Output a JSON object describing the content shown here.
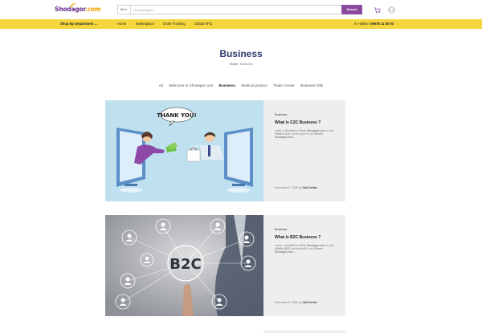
{
  "header": {
    "logo_text": "Shodagor",
    "logo_suffix": ".com",
    "search": {
      "category": "All",
      "placeholder": "I'm looking for...",
      "button_label": "Search"
    },
    "colors": {
      "brand": "#6b2d8f",
      "accent": "#f5d63d",
      "search_button": "#8b4aa0"
    },
    "icons": [
      "cart-icon",
      "user-avatar-icon"
    ]
  },
  "navbar": {
    "department_label": "Shop By Department",
    "links": [
      "Home",
      "Marketplace",
      "Order Tracking",
      "Global RFQ"
    ],
    "hotline_label": "Hotline:",
    "hotline_number": "09678 11 00 00"
  },
  "page": {
    "title": "Business",
    "breadcrumb_home": "Home",
    "breadcrumb_sep": "/",
    "breadcrumb_current": "Business"
  },
  "filters": {
    "items": [
      "All",
      "Welcome to Shodagor.com",
      "Business",
      "Medical product",
      "Trade Center",
      "Business Talk"
    ],
    "active": "Business"
  },
  "posts": [
    {
      "category": "Business",
      "title": "What is C2C Business ?",
      "excerpt": "ব্যবসা ও অনলাইনের মাধ্যমে Shodagor.com এর মত প্রতিষ্ঠান C2C ব্যবসার সুযোগ দেয়। বিক্রেতা Shodagor.com....",
      "date": "November 5, 2019",
      "by": "by",
      "author": "Call Center",
      "image_text": "THANK YOU!"
    },
    {
      "category": "Business",
      "title": "What is B2C Business ?",
      "excerpt": "ব্যবসা ও অনলাইনের মাধ্যমে Shodagor.com এর মত প্রতিষ্ঠান B2C ব্যবসার সুযোগ দেয়। বিক্রেতা Shodagor.com....",
      "date": "November 5, 2019",
      "by": "by",
      "author": "Call Center",
      "image_text": "B2C"
    }
  ]
}
